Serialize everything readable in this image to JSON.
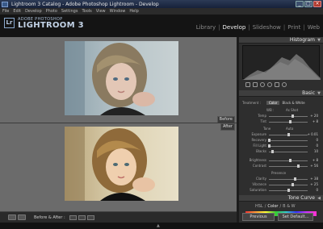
{
  "window": {
    "title": "Lightroom 3 Catalog - Adobe Photoshop Lightroom - Develop",
    "min": "_",
    "max": "□",
    "close": "×"
  },
  "menu": [
    "File",
    "Edit",
    "Develop",
    "Photo",
    "Settings",
    "Tools",
    "View",
    "Window",
    "Help"
  ],
  "identity": {
    "badge": "Lr",
    "adobe": "ADOBE PHOTOSHOP",
    "product": "LIGHTROOM 3",
    "modules": [
      {
        "label": "Library",
        "active": false
      },
      {
        "label": "Develop",
        "active": true
      },
      {
        "label": "Slideshow",
        "active": false
      },
      {
        "label": "Print",
        "active": false
      },
      {
        "label": "Web",
        "active": false
      }
    ]
  },
  "compare": {
    "before_label": "Before",
    "after_label": "After"
  },
  "toolbar": {
    "before_after_label": "Before & After :"
  },
  "panel": {
    "histogram_title": "Histogram",
    "basic_title": "Basic",
    "treatment": {
      "label": "Treatment :",
      "options": [
        "Color",
        "Black & White"
      ],
      "active": "Color"
    },
    "wb": {
      "label": "WB :",
      "value": "As Shot"
    },
    "temp": {
      "label": "Temp",
      "value": "+ 20",
      "level": 0.62
    },
    "tint": {
      "label": "Tint",
      "value": "+ 8",
      "level": 0.55
    },
    "tone": {
      "label": "Tone",
      "value": "Auto"
    },
    "exposure": {
      "label": "Exposure",
      "value": "+ 0.01",
      "level": 0.5
    },
    "recovery": {
      "label": "Recovery",
      "value": "0",
      "level": 0.0
    },
    "fill_light": {
      "label": "Fill Light",
      "value": "0",
      "level": 0.0
    },
    "blacks": {
      "label": "Blacks",
      "value": "10",
      "level": 0.1
    },
    "brightness": {
      "label": "Brightness",
      "value": "+ 8",
      "level": 0.55
    },
    "contrast": {
      "label": "Contrast",
      "value": "+ 56",
      "level": 0.75
    },
    "presence": {
      "label": "Presence"
    },
    "clarity": {
      "label": "Clarity",
      "value": "+ 38",
      "level": 0.68
    },
    "vibrance": {
      "label": "Vibrance",
      "value": "+ 25",
      "level": 0.62
    },
    "saturation": {
      "label": "Saturation",
      "value": "0",
      "level": 0.5
    },
    "tone_curve_title": "Tone Curve",
    "hsl_tabs": [
      "HSL",
      "/",
      "Color",
      "/",
      "B & W"
    ],
    "prev_button": "Previous",
    "reset_button": "Set Default..."
  },
  "colors": {
    "accent": "#c4d4e8",
    "panel_bg": "#2e2e2e",
    "content_bg": "#6b6b6b"
  }
}
